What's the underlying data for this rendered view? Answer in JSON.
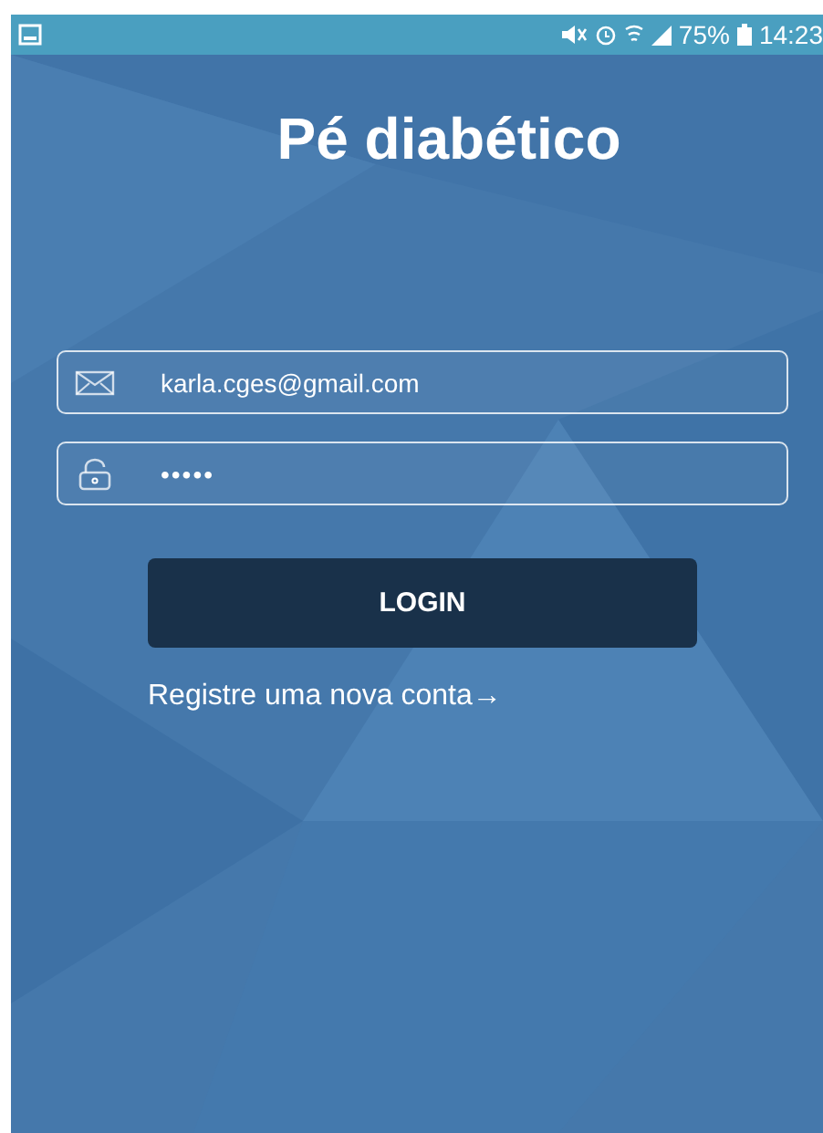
{
  "status_bar": {
    "battery": "75%",
    "time": "14:23"
  },
  "title": "Pé diabético",
  "fields": [
    {
      "kind": "email",
      "value": "karla.cges@gmail.com"
    },
    {
      "kind": "password",
      "value": "•••••"
    }
  ],
  "login_button": "LOGIN",
  "register_link": "Registre uma nova conta→"
}
